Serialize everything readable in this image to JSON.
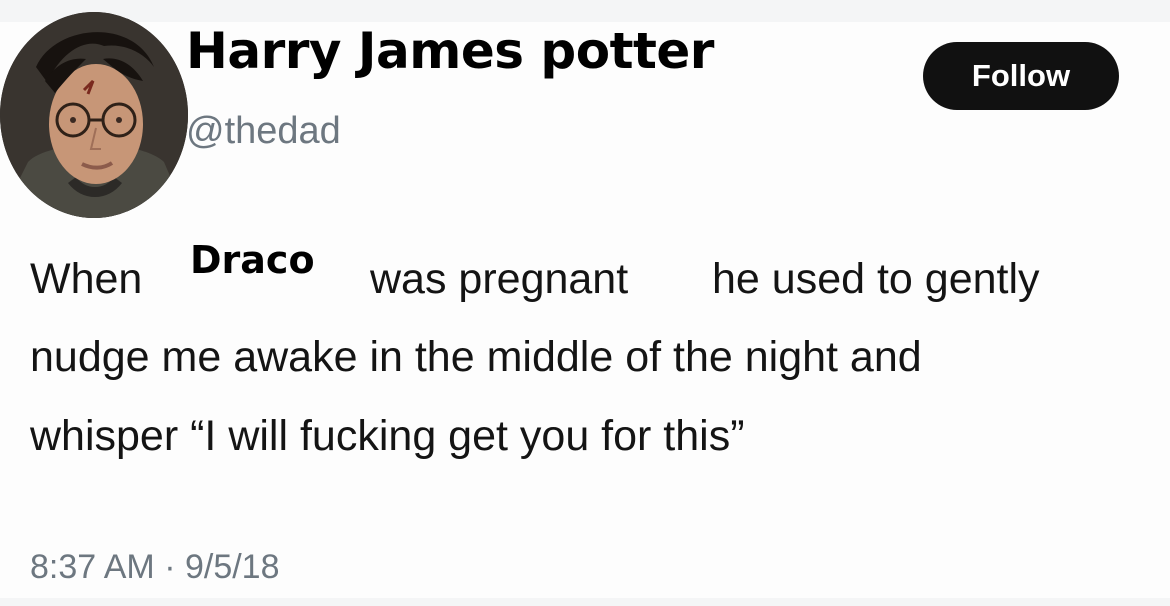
{
  "tweet": {
    "display_name": "Harry James potter",
    "handle": "@thedad",
    "follow_label": "Follow",
    "text_lines": [
      "When",
      "was pregnant",
      "he used to gently",
      "nudge me awake in the middle of the night and",
      "whisper “I will fucking get you for this”"
    ],
    "overlay_name": "Draco",
    "timestamp": "8:37 AM · 9/5/18",
    "avatar_icon": "profile-photo"
  },
  "colors": {
    "text": "#141414",
    "secondary_text": "#6d7780",
    "button_background": "#111111",
    "button_text": "#ffffff",
    "background": "#fdfdfd"
  }
}
